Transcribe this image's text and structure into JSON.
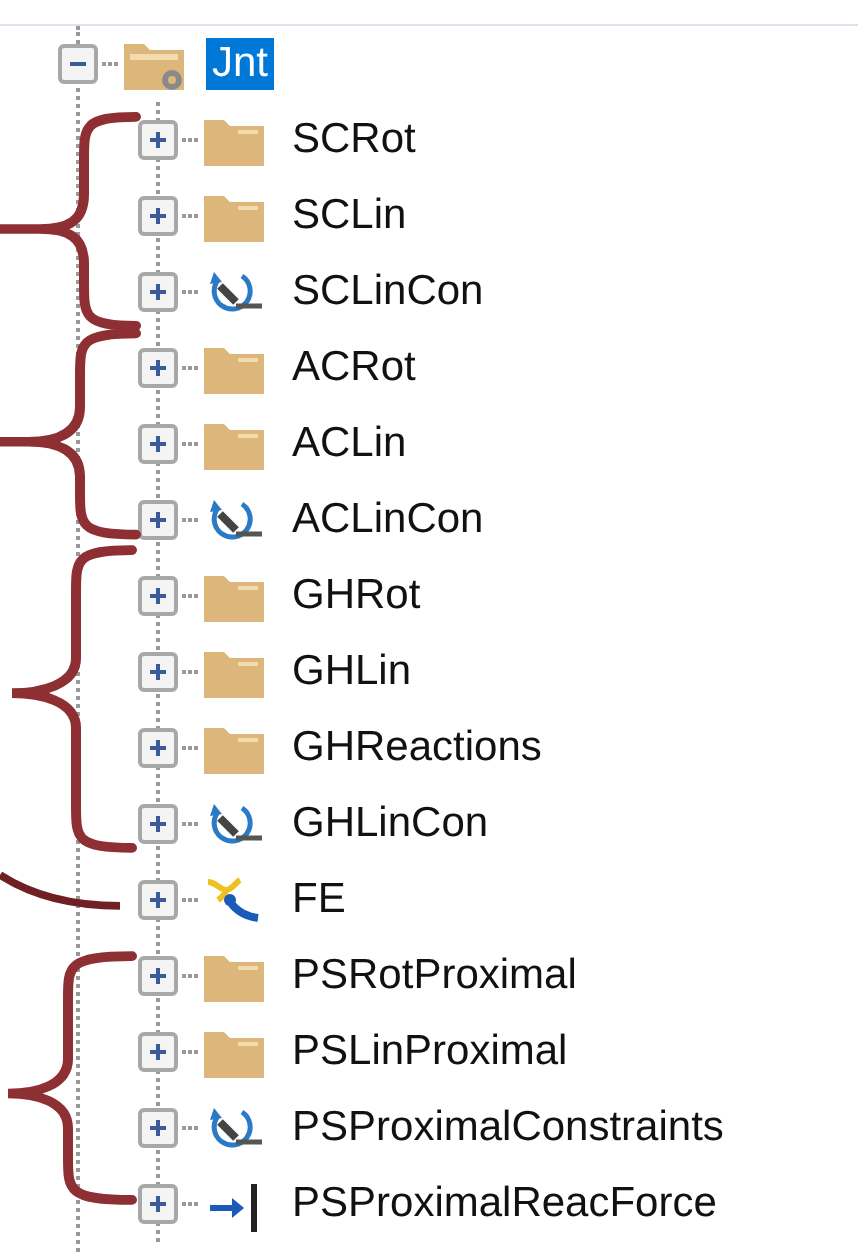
{
  "tree": [
    {
      "label": "Jnt",
      "kind": "assembly",
      "expanded": true,
      "selected": true,
      "children": [
        {
          "label": "SCRot",
          "kind": "folder",
          "expanded": false,
          "selected": false
        },
        {
          "label": "SCLin",
          "kind": "folder",
          "expanded": false,
          "selected": false
        },
        {
          "label": "SCLinCon",
          "kind": "constraint",
          "expanded": false,
          "selected": false
        },
        {
          "label": "ACRot",
          "kind": "folder",
          "expanded": false,
          "selected": false
        },
        {
          "label": "ACLin",
          "kind": "folder",
          "expanded": false,
          "selected": false
        },
        {
          "label": "ACLinCon",
          "kind": "constraint",
          "expanded": false,
          "selected": false
        },
        {
          "label": "GHRot",
          "kind": "folder",
          "expanded": false,
          "selected": false
        },
        {
          "label": "GHLin",
          "kind": "folder",
          "expanded": false,
          "selected": false
        },
        {
          "label": "GHReactions",
          "kind": "folder",
          "expanded": false,
          "selected": false
        },
        {
          "label": "GHLinCon",
          "kind": "constraint",
          "expanded": false,
          "selected": false
        },
        {
          "label": "FE",
          "kind": "fe",
          "expanded": false,
          "selected": false
        },
        {
          "label": "PSRotProximal",
          "kind": "folder",
          "expanded": false,
          "selected": false
        },
        {
          "label": "PSLinProximal",
          "kind": "folder",
          "expanded": false,
          "selected": false
        },
        {
          "label": "PSProximalConstraints",
          "kind": "constraint",
          "expanded": false,
          "selected": false
        },
        {
          "label": "PSProximalReacForce",
          "kind": "force",
          "expanded": false,
          "selected": false
        }
      ]
    }
  ]
}
